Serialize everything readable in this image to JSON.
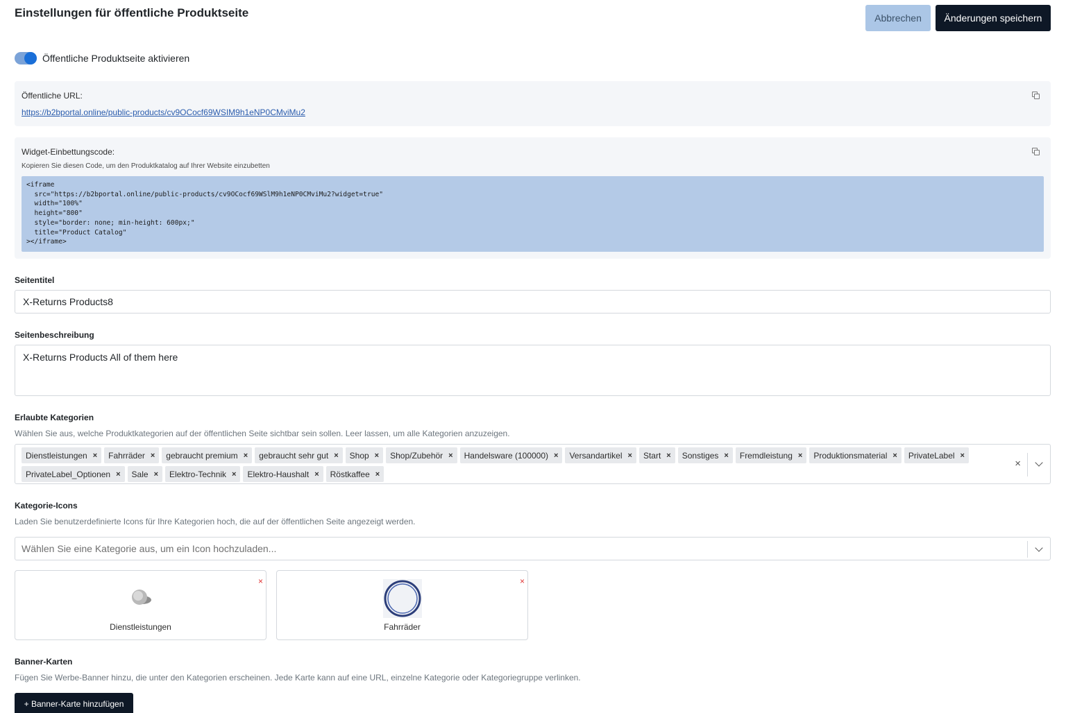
{
  "header": {
    "title": "Einstellungen für öffentliche Produktseite",
    "cancel_label": "Abbrechen",
    "save_label": "Änderungen speichern"
  },
  "toggle": {
    "label": "Öffentliche Produktseite aktivieren",
    "enabled": true
  },
  "public_url": {
    "label": "Öffentliche URL:",
    "url": "https://b2bportal.online/public-products/cv9OCocf69WSIM9h1eNP0CMviMu2",
    "copy_icon": "copy-icon"
  },
  "widget": {
    "label": "Widget-Einbettungscode:",
    "hint": "Kopieren Sie diesen Code, um den Produktkatalog auf Ihrer Website einzubetten",
    "code": "<iframe\n  src=\"https://b2bportal.online/public-products/cv9OCocf69WSlM9h1eNP0CMviMu2?widget=true\"\n  width=\"100%\"\n  height=\"800\"\n  style=\"border: none; min-height: 600px;\"\n  title=\"Product Catalog\"\n></iframe>",
    "copy_icon": "copy-icon"
  },
  "page_title": {
    "label": "Seitentitel",
    "value": "X-Returns Products8"
  },
  "page_description": {
    "label": "Seitenbeschreibung",
    "value": "X-Returns Products All of them here"
  },
  "categories": {
    "label": "Erlaubte Kategorien",
    "help": "Wählen Sie aus, welche Produktkategorien auf der öffentlichen Seite sichtbar sein sollen. Leer lassen, um alle Kategorien anzuzeigen.",
    "selected": [
      "Dienstleistungen",
      "Fahrräder",
      "gebraucht premium",
      "gebraucht sehr gut",
      "Shop",
      "Shop/Zubehör",
      "Handelsware (100000)",
      "Versandartikel",
      "Start",
      "Sonstiges",
      "Fremdleistung",
      "Produktionsmaterial",
      "PrivateLabel",
      "PrivateLabel_Optionen",
      "Sale",
      "Elektro-Technik",
      "Elektro-Haushalt",
      "Röstkaffee"
    ],
    "chip_remove": "×",
    "clear_symbol": "×"
  },
  "category_icons": {
    "label": "Kategorie-Icons",
    "help": "Laden Sie benutzerdefinierte Icons für Ihre Kategorien hoch, die auf der öffentlichen Seite angezeigt werden.",
    "select_placeholder": "Wählen Sie eine Kategorie aus, um ein Icon hochzuladen...",
    "cards": [
      {
        "name": "Dienstleistungen",
        "icon": "coin-icon"
      },
      {
        "name": "Fahrräder",
        "icon": "ring-icon"
      }
    ],
    "remove_symbol": "×"
  },
  "banner": {
    "label": "Banner-Karten",
    "help": "Fügen Sie Werbe-Banner hinzu, die unter den Kategorien erscheinen. Jede Karte kann auf eine URL, einzelne Kategorie oder Kategoriegruppe verlinken.",
    "add_label": "+ Banner-Karte hinzufügen"
  },
  "colors": {
    "primary_dark": "#0e1826",
    "cancel_bg": "#abc6e6",
    "toggle_on": "#1a6fd8",
    "link": "#2a5cad",
    "code_bg": "#b4cae7",
    "remove_red": "#e03434"
  }
}
